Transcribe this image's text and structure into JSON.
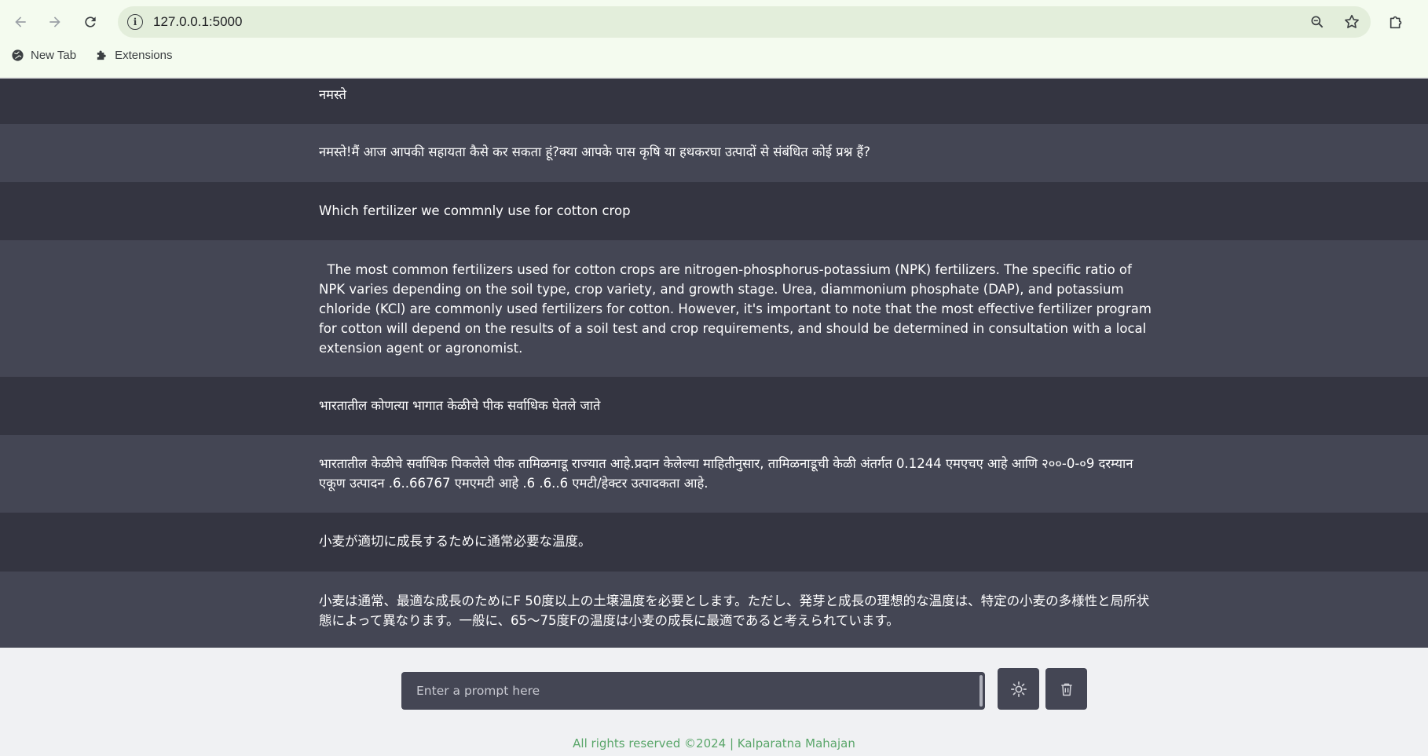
{
  "browser": {
    "url": "127.0.0.1:5000",
    "bookmarks": [
      {
        "label": "New Tab",
        "icon": "globe-icon"
      },
      {
        "label": "Extensions",
        "icon": "puzzle-icon"
      }
    ]
  },
  "messages": [
    {
      "role": "user",
      "text": "नमस्ते"
    },
    {
      "role": "bot",
      "text": "नमस्ते!मैं आज आपकी सहायता कैसे कर सकता हूं?क्या आपके पास कृषि या हथकरघा उत्पादों से संबंधित कोई प्रश्न हैं?"
    },
    {
      "role": "user",
      "text": "Which fertilizer we commnly use for cotton crop"
    },
    {
      "role": "bot",
      "text": "  The most common fertilizers used for cotton crops are nitrogen-phosphorus-potassium (NPK) fertilizers. The specific ratio of NPK varies depending on the soil type, crop variety, and growth stage. Urea, diammonium phosphate (DAP), and potassium chloride (KCl) are commonly used fertilizers for cotton. However, it's important to note that the most effective fertilizer program for cotton will depend on the results of a soil test and crop requirements, and should be determined in consultation with a local extension agent or agronomist."
    },
    {
      "role": "user",
      "text": "भारतातील कोणत्या भागात केळीचे पीक सर्वाधिक घेतले जाते"
    },
    {
      "role": "bot",
      "text": "भारतातील केळीचे सर्वाधिक पिकलेले पीक तामिळनाडू राज्यात आहे.प्रदान केलेल्या माहितीनुसार, तामिळनाडूची केळी अंतर्गत 0.1244 एमएचए आहे आणि २००-0-०9 दरम्यान एकूण उत्पादन .6..66767 एमएमटी आहे .6 .6..6 एमटी/हेक्टर उत्पादकता आहे."
    },
    {
      "role": "user",
      "text": "小麦が適切に成長するために通常必要な温度。"
    },
    {
      "role": "bot",
      "text": "小麦は通常、最適な成長のためにF 50度以上の土壌温度を必要とします。ただし、発芽と成長の理想的な温度は、特定の小麦の多様性と局所状態によって異なります。一般に、65〜75度Fの温度は小麦の成長に最適であると考えられています。"
    }
  ],
  "input": {
    "placeholder": "Enter a prompt here"
  },
  "buttons": {
    "theme_icon": "sun-icon",
    "delete_icon": "trash-icon"
  },
  "footer": {
    "text": "All rights reserved ©2024 | Kalparatna Mahajan"
  }
}
